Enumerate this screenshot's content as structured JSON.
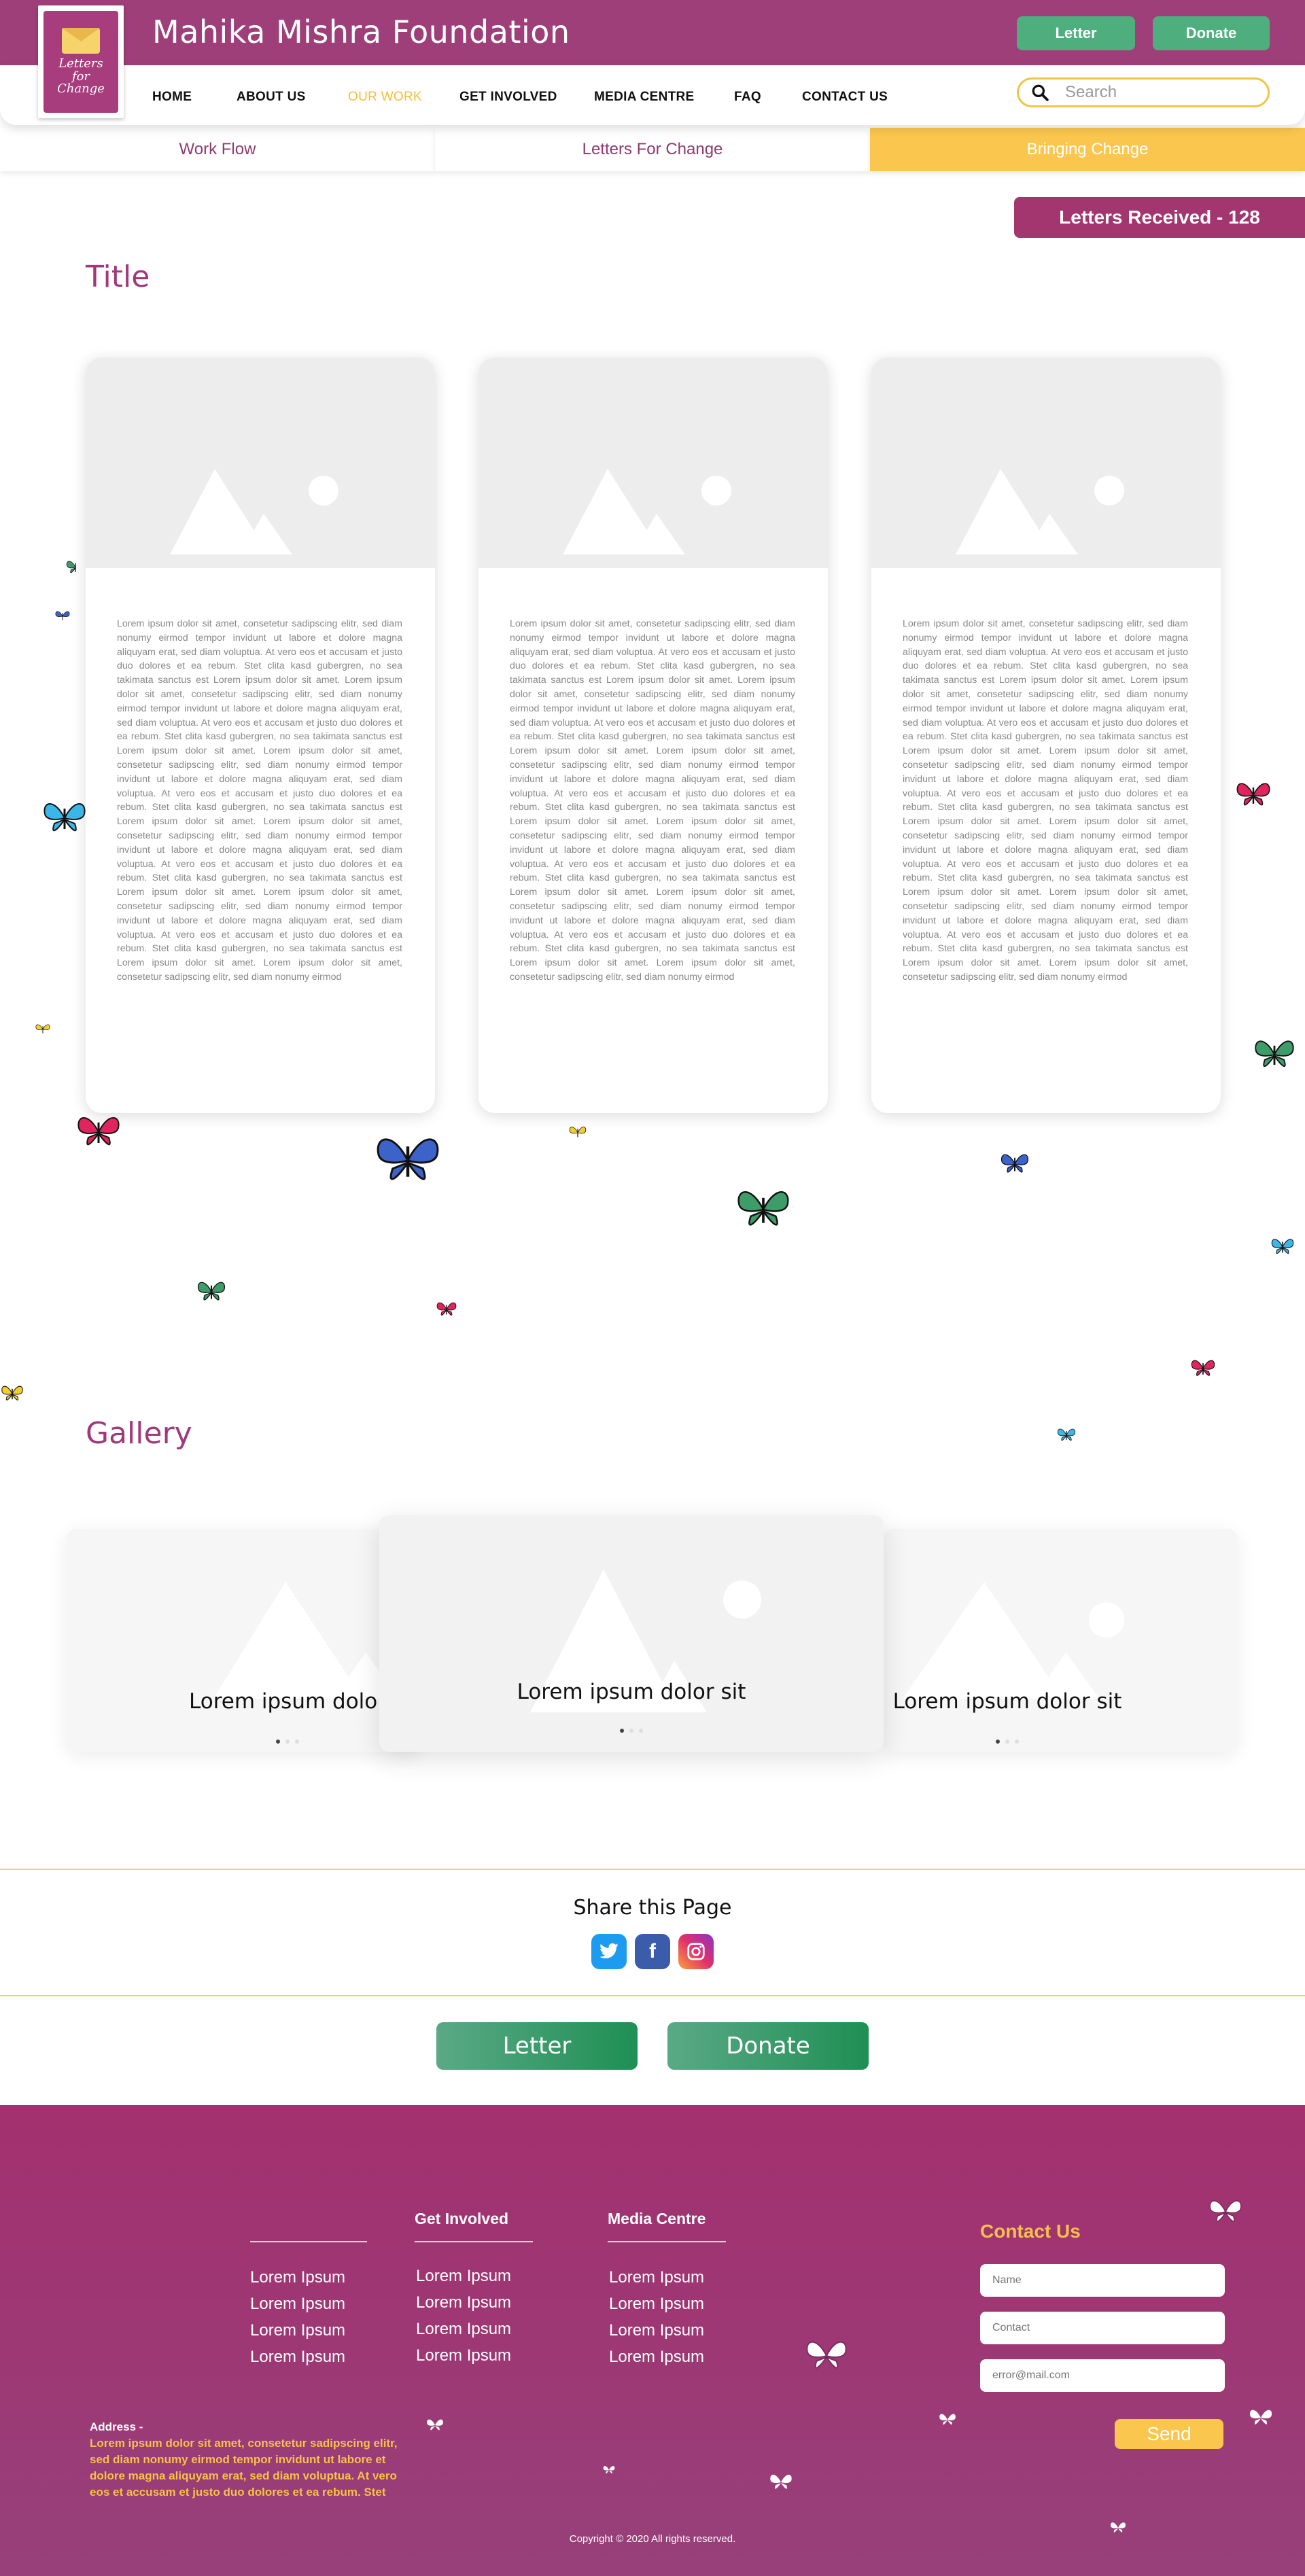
{
  "header": {
    "site_title": "Mahika Mishra Foundation",
    "logo_text": "Letters for Change",
    "letter_button": "Letter",
    "donate_button": "Donate"
  },
  "nav": {
    "items": [
      "HOME",
      "ABOUT US",
      "OUR WORK",
      "GET INVOLVED",
      "MEDIA CENTRE",
      "FAQ",
      "CONTACT US"
    ],
    "active": "OUR WORK",
    "search_placeholder": "Search"
  },
  "subtabs": {
    "items": [
      "Work Flow",
      "Letters For Change",
      "Bringing Change"
    ],
    "active": "Bringing Change"
  },
  "letters_badge": "Letters Received - 128",
  "main": {
    "title": "Title",
    "card_text": "Lorem ipsum dolor sit amet, consetetur sadipscing elitr, sed diam nonumy eirmod tempor invidunt ut labore et dolore magna aliquyam erat, sed diam voluptua. At vero eos et accusam et justo duo dolores et ea rebum. Stet clita kasd gubergren, no sea takimata sanctus est Lorem ipsum dolor sit amet. Lorem ipsum dolor sit amet, consetetur sadipscing elitr, sed diam nonumy eirmod tempor invidunt ut labore et dolore magna aliquyam erat, sed diam voluptua. At vero eos et accusam et justo duo dolores et ea rebum. Stet clita kasd gubergren, no sea takimata sanctus est Lorem ipsum dolor sit amet. Lorem ipsum dolor sit amet, consetetur sadipscing elitr, sed diam nonumy eirmod tempor invidunt ut labore et dolore magna aliquyam erat, sed diam voluptua. At vero eos et accusam et justo duo dolores et ea rebum. Stet clita kasd gubergren, no sea takimata sanctus est Lorem ipsum dolor sit amet. Lorem ipsum dolor sit amet, consetetur sadipscing elitr, sed diam nonumy eirmod tempor invidunt ut labore et dolore magna aliquyam erat, sed diam voluptua. At vero eos et accusam et justo duo dolores et ea rebum. Stet clita kasd gubergren, no sea takimata sanctus est Lorem ipsum dolor sit amet. Lorem ipsum dolor sit amet, consetetur sadipscing elitr, sed diam nonumy eirmod tempor invidunt ut labore et dolore magna aliquyam erat, sed diam voluptua. At vero eos et accusam et justo duo dolores et ea rebum. Stet clita kasd gubergren, no sea takimata sanctus est Lorem ipsum dolor sit amet. Lorem ipsum dolor sit amet, consetetur sadipscing elitr, sed diam nonumy eirmod"
  },
  "gallery": {
    "title": "Gallery",
    "left_caption": "Lorem ipsum dolor",
    "center_caption": "Lorem ipsum dolor sit",
    "right_caption": "Lorem ipsum dolor sit"
  },
  "share": {
    "title": "Share this Page",
    "icons": [
      "twitter-icon",
      "facebook-icon",
      "instagram-icon"
    ]
  },
  "cta": {
    "letter": "Letter",
    "donate": "Donate"
  },
  "footer": {
    "columns": [
      {
        "title": "",
        "links": [
          "Lorem Ipsum",
          "Lorem Ipsum",
          "Lorem Ipsum",
          "Lorem Ipsum"
        ]
      },
      {
        "title": "Get Involved",
        "links": [
          "Lorem Ipsum",
          "Lorem Ipsum",
          "Lorem Ipsum",
          "Lorem Ipsum"
        ]
      },
      {
        "title": "Media Centre",
        "links": [
          "Lorem Ipsum",
          "Lorem Ipsum",
          "Lorem Ipsum",
          "Lorem Ipsum"
        ]
      }
    ],
    "contact_title": "Contact Us",
    "name_placeholder": "Name",
    "contact_placeholder": "Contact",
    "email_placeholder": "error@mail.com",
    "send_button": "Send",
    "address_label": "Address -",
    "address_text": "Lorem ipsum dolor sit amet, consetetur sadipscing elitr, sed diam nonumy eirmod tempor invidunt ut labore et dolore magna aliquyam erat, sed diam voluptua. At vero eos et accusam et justo duo dolores et ea rebum. Stet",
    "copyright": "Copyright © 2020 All rights reserved."
  },
  "colors": {
    "brand": "#9e3f7a",
    "accent": "#f6be3a",
    "green": "#4fae7e",
    "footer": "#a3306f"
  }
}
